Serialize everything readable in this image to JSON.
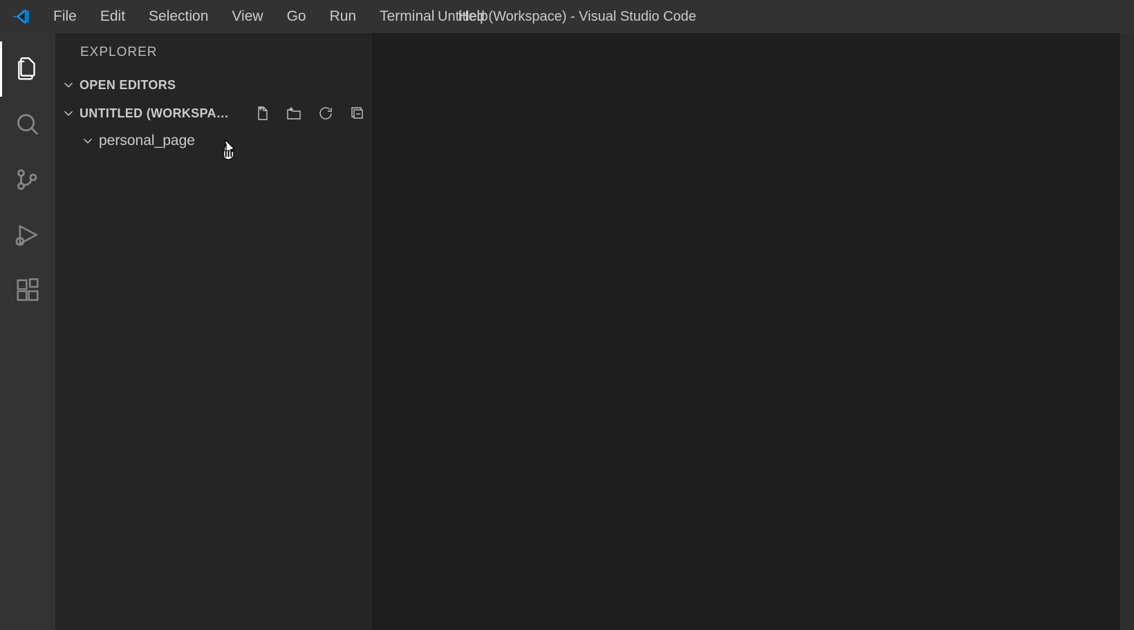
{
  "window_title": "Untitled (Workspace) - Visual Studio Code",
  "menu": [
    "File",
    "Edit",
    "Selection",
    "View",
    "Go",
    "Run",
    "Terminal",
    "Help"
  ],
  "sidebar": {
    "title": "EXPLORER",
    "sections": {
      "open_editors_label": "OPEN EDITORS",
      "workspace_label": "UNTITLED (WORKSPA…"
    },
    "tree": {
      "folder_0_label": "personal_page"
    },
    "action_icons": {
      "new_file": "new-file-icon",
      "new_folder": "new-folder-icon",
      "refresh": "refresh-icon",
      "collapse": "collapse-all-icon"
    }
  },
  "activity": [
    "explorer",
    "search",
    "source-control",
    "run-debug",
    "extensions"
  ]
}
